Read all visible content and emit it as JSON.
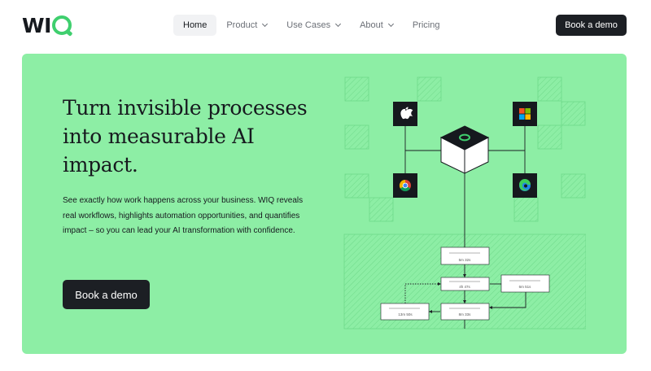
{
  "nav": {
    "logo_text": "WI",
    "items": [
      {
        "label": "Home"
      },
      {
        "label": "Product"
      },
      {
        "label": "Use Cases"
      },
      {
        "label": "About"
      },
      {
        "label": "Pricing"
      }
    ],
    "cta_label": "Book a demo"
  },
  "hero": {
    "headline": "Turn invisible processes into measurable AI impact.",
    "subcopy": "See exactly how work happens across your business. WIQ reveals real workflows, highlights automation opportunities, and quantifies impact – so you can lead your AI transformation with confidence.",
    "cta_label": "Book a demo",
    "illustration": {
      "durations": [
        "5m 32s",
        "4h 47s",
        "6m 51s",
        "13m 50s",
        "8m 33s"
      ],
      "icons": [
        "apple-icon",
        "microsoft-icon",
        "chrome-icon",
        "edge-icon",
        "wiq-cube-icon"
      ]
    }
  },
  "colors": {
    "accent": "#8deea5",
    "brand_green": "#3fcf6e",
    "dark": "#1c1f24"
  }
}
